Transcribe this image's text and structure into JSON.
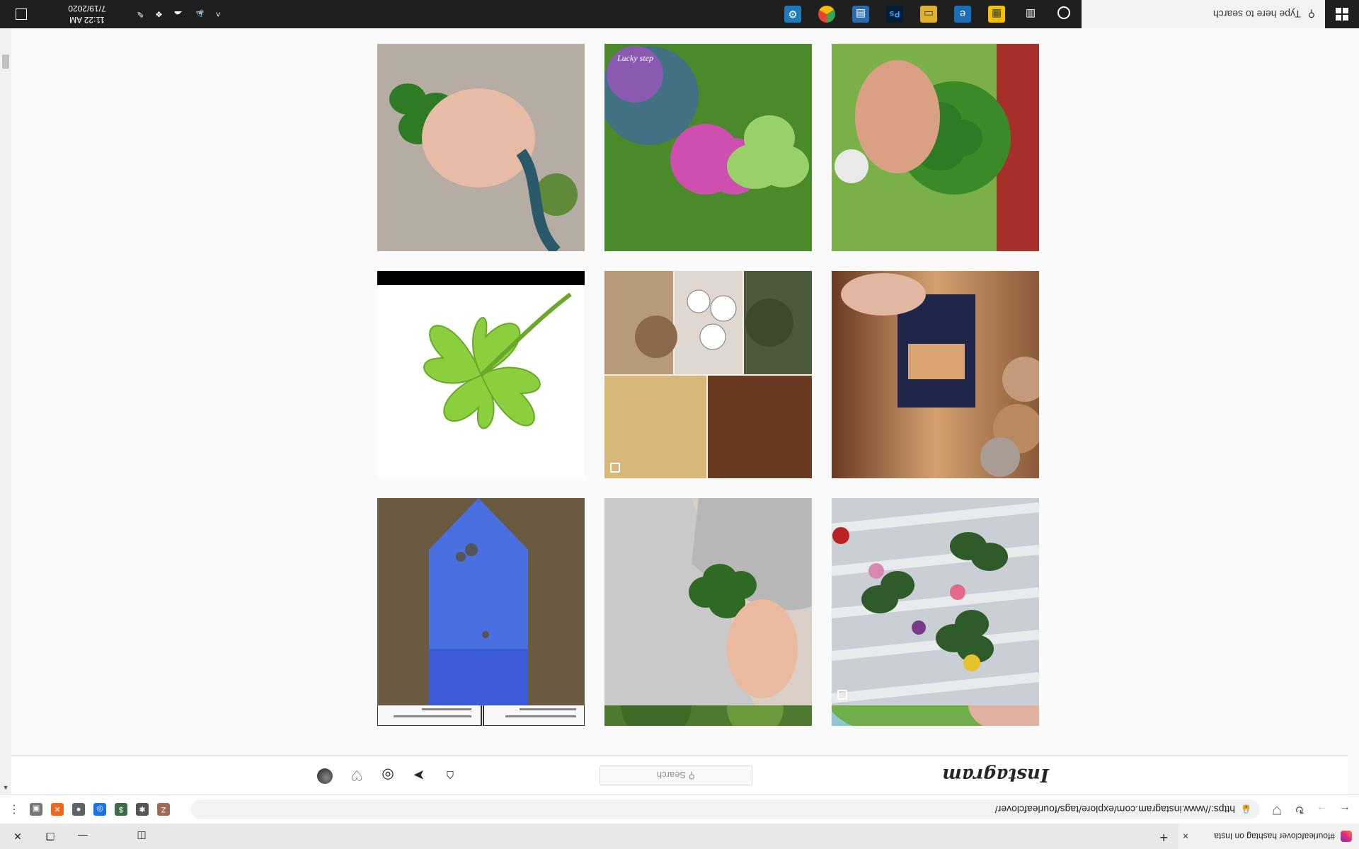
{
  "browser": {
    "tab_title": "#fourleafclover hashtag on Insta",
    "tab_close": "×",
    "new_tab": "+",
    "url": "https://www.instagram.com/explore/tags/fourleafclover/",
    "extensions": [
      {
        "name": "profile",
        "label": "Z",
        "color": "#a06a5a"
      },
      {
        "name": "puzzle",
        "label": "✱",
        "color": "#555555"
      },
      {
        "name": "money",
        "label": "$",
        "color": "#3d6b4a"
      },
      {
        "name": "ext-blue",
        "label": "◎",
        "color": "#1a73e8"
      },
      {
        "name": "ext-grey",
        "label": "●",
        "color": "#5f6368"
      },
      {
        "name": "ext-orange",
        "label": "✕",
        "color": "#ea6a1e"
      },
      {
        "name": "ext-square",
        "label": "▣",
        "color": "#777777"
      }
    ]
  },
  "instagram": {
    "logo": "Instagram",
    "search_placeholder": "Search"
  },
  "grid": [
    {
      "name": "clover-crochet-row-1",
      "kind": "partial-docs"
    },
    {
      "name": "clover-grass-1",
      "kind": "grass"
    },
    {
      "name": "clover-leaves-1",
      "kind": "leaves"
    }
  ],
  "taskbar": {
    "search_placeholder": "Type here to search",
    "time": "11:22 AM",
    "date": "7/19/2020"
  }
}
